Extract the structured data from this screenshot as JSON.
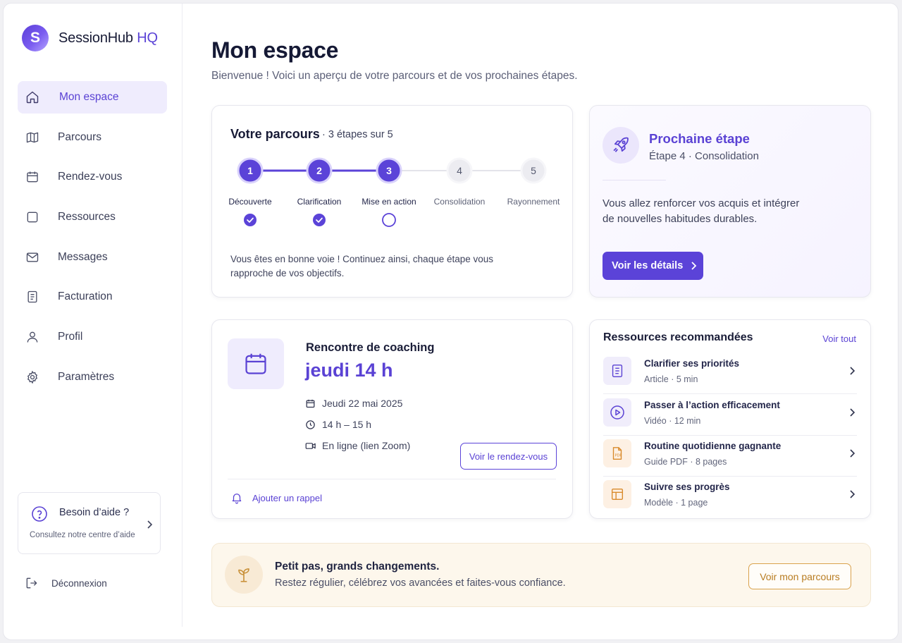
{
  "brand": {
    "initial": "S",
    "name": "SessionHub",
    "suffix": "HQ"
  },
  "sidebar": {
    "items": [
      {
        "label": "Mon espace",
        "icon": "home-icon",
        "active": true
      },
      {
        "label": "Parcours",
        "icon": "map-icon"
      },
      {
        "label": "Rendez-vous",
        "icon": "calendar-icon"
      },
      {
        "label": "Ressources",
        "icon": "square-icon"
      },
      {
        "label": "Messages",
        "icon": "mail-icon"
      },
      {
        "label": "Facturation",
        "icon": "invoice-icon"
      },
      {
        "label": "Profil",
        "icon": "user-icon"
      },
      {
        "label": "Paramètres",
        "icon": "gear-icon"
      }
    ],
    "help": {
      "title": "Besoin d’aide ?",
      "subtitle": "Consultez notre centre d’aide"
    },
    "logout": "Déconnexion"
  },
  "header": {
    "title": "Mon espace",
    "subtitle": "Bienvenue ! Voici un aperçu de votre parcours et de vos prochaines étapes."
  },
  "parcours": {
    "title": "Votre parcours",
    "count": "· 3 étapes sur 5",
    "completed": 2,
    "current": 3,
    "steps": [
      {
        "number": "1",
        "label": "Découverte",
        "status": "done"
      },
      {
        "number": "2",
        "label": "Clarification",
        "status": "done"
      },
      {
        "number": "3",
        "label": "Mise en action",
        "status": "current"
      },
      {
        "number": "4",
        "label": "Consolidation",
        "status": "upcoming"
      },
      {
        "number": "5",
        "label": "Rayonnement",
        "status": "upcoming"
      }
    ],
    "message": "Vous êtes en bonne voie ! Continuez ainsi, chaque étape vous rapproche de vos objectifs."
  },
  "next_step": {
    "title": "Prochaine étape",
    "subtitle": "Étape 4 · Consolidation",
    "description": "Vous allez renforcer vos acquis et intégrer de nouvelles habitudes durables.",
    "button": "Voir les détails"
  },
  "meeting": {
    "label": "Rencontre de coaching",
    "time": "jeudi 14 h",
    "date": "Jeudi 22 mai 2025",
    "hours": "14 h – 15 h",
    "location": "En ligne (lien Zoom)",
    "button": "Voir le rendez-vous",
    "reminder": "Ajouter un rappel"
  },
  "resources": {
    "title": "Ressources recommandées",
    "see_all": "Voir tout",
    "items": [
      {
        "name": "Clarifier ses priorités",
        "type": "Article",
        "detail": "5 min",
        "icon": "document-icon",
        "tone": "purple"
      },
      {
        "name": "Passer à l’action efficacement",
        "type": "Vidéo",
        "detail": "12 min",
        "icon": "play-icon",
        "tone": "purple"
      },
      {
        "name": "Routine quotidienne gagnante",
        "type": "Guide PDF",
        "detail": "8 pages",
        "icon": "pdf-icon",
        "tone": "orange"
      },
      {
        "name": "Suivre ses progrès",
        "type": "Modèle",
        "detail": "1 page",
        "icon": "template-icon",
        "tone": "orange"
      }
    ]
  },
  "tip": {
    "title": "Petit pas, grands changements.",
    "subtitle": "Restez régulier, célébrez vos avancées et faites-vous confiance.",
    "button": "Voir mon parcours"
  },
  "colors": {
    "accent": "#5b43d8",
    "accent_light": "#efecfd",
    "gold": "#d9a24d",
    "muted": "#e3e3ea"
  }
}
